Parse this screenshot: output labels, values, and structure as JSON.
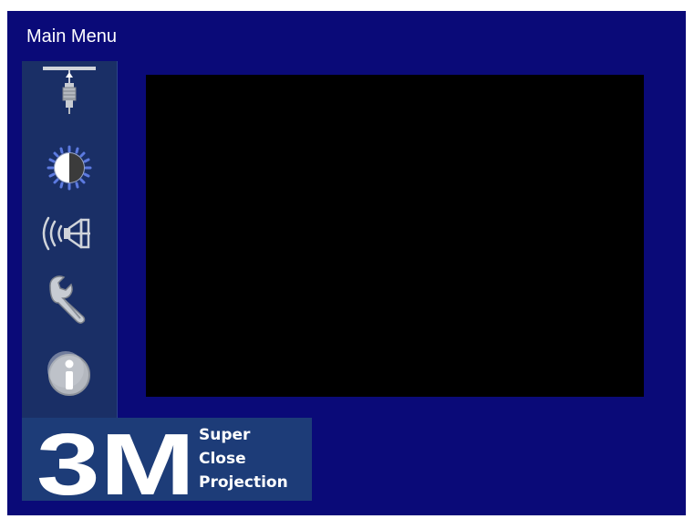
{
  "menu": {
    "title": "Main Menu"
  },
  "sidebar": {
    "items": [
      {
        "name": "picture-adjust",
        "icon": "keystone-adjust-icon"
      },
      {
        "name": "brightness",
        "icon": "brightness-dial-icon"
      },
      {
        "name": "audio",
        "icon": "speaker-sound-icon"
      },
      {
        "name": "setup",
        "icon": "wrench-icon"
      },
      {
        "name": "information",
        "icon": "info-icon"
      }
    ]
  },
  "logo": {
    "brand": "3M",
    "line1": "Super",
    "line2": "Close",
    "line3": "Projection"
  },
  "colors": {
    "background": "#0a0a78",
    "sidebar": "#1a2f66",
    "preview": "#000000",
    "logo_panel": "#1d3c78",
    "icon_gray": "#b4b8bf"
  }
}
